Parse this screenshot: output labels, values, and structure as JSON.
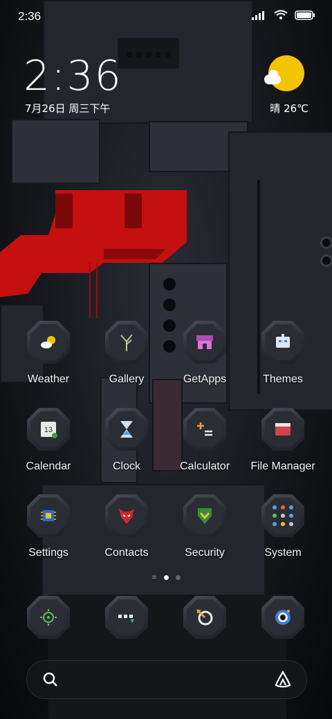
{
  "status_bar": {
    "time": "2:36"
  },
  "clock_widget": {
    "time": "2:36",
    "date": "7月26日 周三下午"
  },
  "weather_widget": {
    "text": "晴 26℃",
    "icon": "sun-cloud-icon"
  },
  "apps": [
    {
      "label": "Weather",
      "icon": "weather-icon"
    },
    {
      "label": "Gallery",
      "icon": "gallery-icon"
    },
    {
      "label": "GetApps",
      "icon": "store-icon"
    },
    {
      "label": "Themes",
      "icon": "themes-icon"
    },
    {
      "label": "Calendar",
      "icon": "calendar-icon",
      "day": "13"
    },
    {
      "label": "Clock",
      "icon": "clock-icon"
    },
    {
      "label": "Calculator",
      "icon": "calculator-icon"
    },
    {
      "label": "File Manager",
      "icon": "folder-icon"
    },
    {
      "label": "Settings",
      "icon": "settings-icon"
    },
    {
      "label": "Contacts",
      "icon": "contacts-icon"
    },
    {
      "label": "Security",
      "icon": "security-icon"
    },
    {
      "label": "System",
      "icon": "system-folder-icon"
    }
  ],
  "dock": [
    {
      "icon": "dock-app-1-icon"
    },
    {
      "icon": "dock-app-2-icon"
    },
    {
      "icon": "dock-app-3-icon"
    },
    {
      "icon": "camera-icon"
    }
  ],
  "pager": {
    "pages": 2,
    "current": 1
  },
  "colors": {
    "accent_red": "#c41010",
    "sun": "#f5c400"
  }
}
